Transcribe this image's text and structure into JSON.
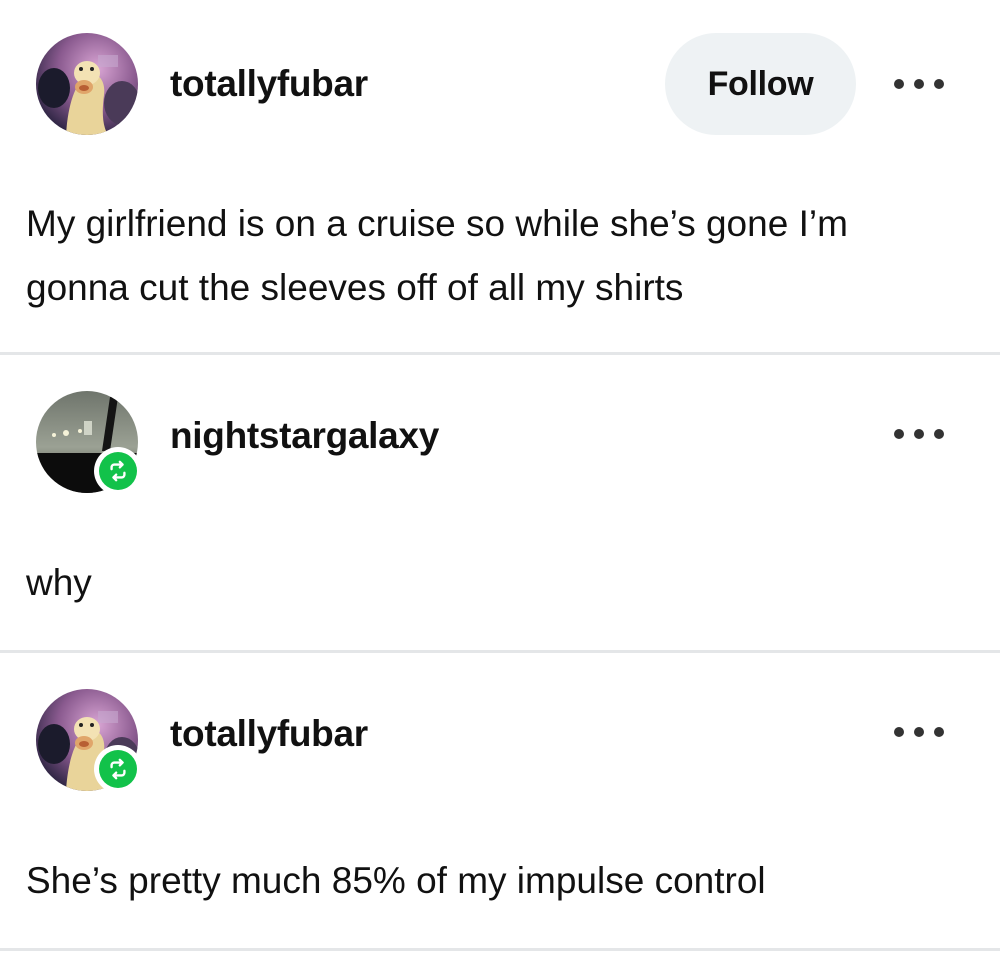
{
  "posts": [
    {
      "username": "totallyfubar",
      "follow_label": "Follow",
      "text": "My girlfriend is on a cruise so while she’s gone I’m gonna cut the sleeves off of all my shirts",
      "reblogged": false
    },
    {
      "username": "nightstargalaxy",
      "text": "why",
      "reblogged": true
    },
    {
      "username": "totallyfubar",
      "text": "She’s pretty much 85% of my impulse control",
      "reblogged": true
    }
  ],
  "icons": {
    "more": "more-options-icon",
    "reblog": "reblog-icon"
  },
  "colors": {
    "reblog_badge": "#12c24a",
    "follow_button_bg": "#eef2f4",
    "divider": "#e4e6e8",
    "text": "#111111"
  }
}
